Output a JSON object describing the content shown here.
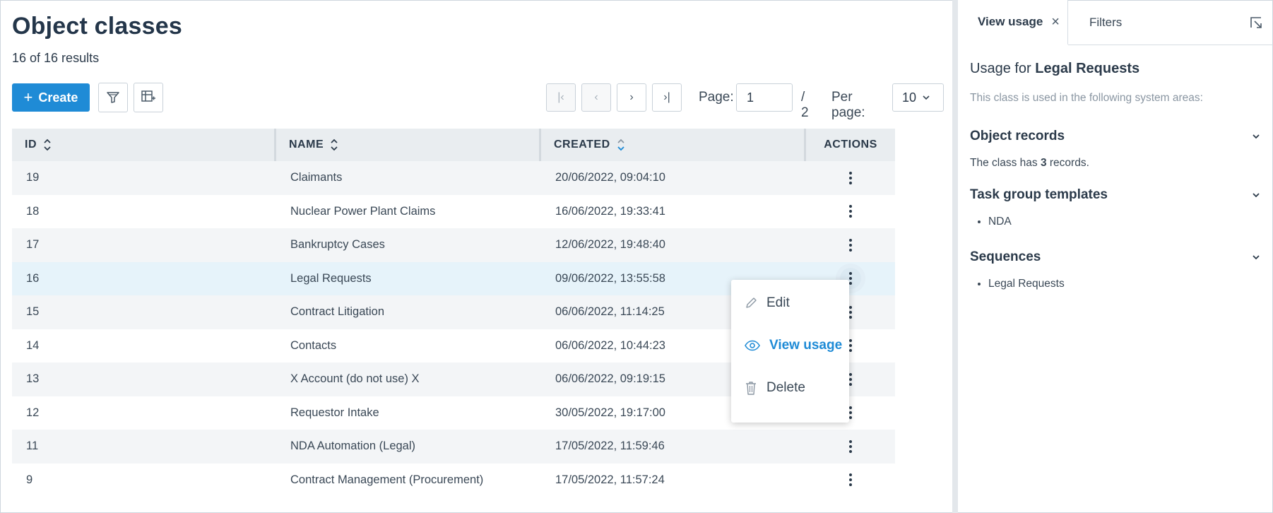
{
  "main": {
    "title": "Object classes",
    "results_text": "16 of 16 results",
    "create_label": "Create"
  },
  "pagination": {
    "page_label": "Page:",
    "page_value": "1",
    "total_pages": "/ 2",
    "per_page_label": "Per page:",
    "per_page_value": "10"
  },
  "table": {
    "headers": {
      "id": "ID",
      "name": "NAME",
      "created": "CREATED",
      "actions": "ACTIONS"
    },
    "rows": [
      {
        "id": "19",
        "name": "Claimants",
        "created": "20/06/2022, 09:04:10"
      },
      {
        "id": "18",
        "name": "Nuclear Power Plant Claims",
        "created": "16/06/2022, 19:33:41"
      },
      {
        "id": "17",
        "name": "Bankruptcy Cases",
        "created": "12/06/2022, 19:48:40"
      },
      {
        "id": "16",
        "name": "Legal Requests",
        "created": "09/06/2022, 13:55:58"
      },
      {
        "id": "15",
        "name": "Contract Litigation",
        "created": "06/06/2022, 11:14:25"
      },
      {
        "id": "14",
        "name": "Contacts",
        "created": "06/06/2022, 10:44:23"
      },
      {
        "id": "13",
        "name": "X Account (do not use) X",
        "created": "06/06/2022, 09:19:15"
      },
      {
        "id": "12",
        "name": "Requestor Intake",
        "created": "30/05/2022, 19:17:00"
      },
      {
        "id": "11",
        "name": "NDA Automation (Legal)",
        "created": "17/05/2022, 11:59:46"
      },
      {
        "id": "9",
        "name": "Contract Management (Procurement)",
        "created": "17/05/2022, 11:57:24"
      }
    ]
  },
  "context_menu": {
    "edit": "Edit",
    "view_usage": "View usage",
    "delete": "Delete"
  },
  "panel": {
    "tab_active": "View usage",
    "tab_inactive": "Filters",
    "usage_prefix": "Usage for",
    "usage_name": "Legal Requests",
    "subtitle": "This class is used in the following system areas:",
    "sections": {
      "records_title": "Object records",
      "records_prefix": "The class has",
      "records_count": "3",
      "records_suffix": "records.",
      "tasks_title": "Task group templates",
      "tasks_item": "NDA",
      "sequences_title": "Sequences",
      "sequences_item": "Legal Requests"
    }
  },
  "colors": {
    "primary": "#1f8bd6",
    "selected_row": "#e6f3fa",
    "header_bg": "#e9edf0"
  }
}
